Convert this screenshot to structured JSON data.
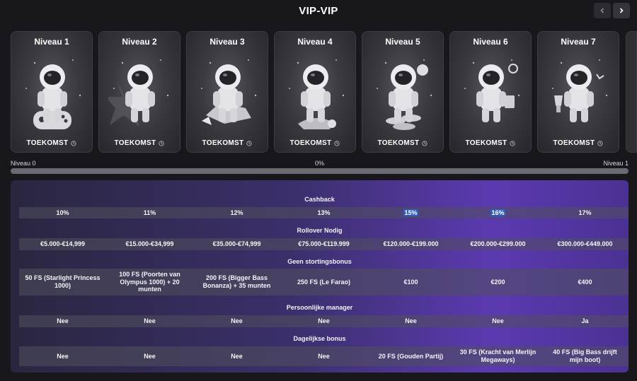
{
  "header": {
    "title": "VIP-VIP"
  },
  "cards": [
    {
      "title": "Niveau 1",
      "status": "TOEKOMST"
    },
    {
      "title": "Niveau 2",
      "status": "TOEKOMST"
    },
    {
      "title": "Niveau 3",
      "status": "TOEKOMST"
    },
    {
      "title": "Niveau 4",
      "status": "TOEKOMST"
    },
    {
      "title": "Niveau 5",
      "status": "TOEKOMST"
    },
    {
      "title": "Niveau 6",
      "status": "TOEKOMST"
    },
    {
      "title": "Niveau 7",
      "status": "TOEKOMST"
    }
  ],
  "progress": {
    "start_label": "Niveau 0",
    "percent_label": "0%",
    "end_label": "Niveau 1",
    "value": 0
  },
  "table": {
    "sections": [
      {
        "title": "Cashback",
        "values": [
          "10%",
          "11%",
          "12%",
          "13%",
          "15%",
          "16%",
          "17%"
        ],
        "highlighted": [
          4,
          5
        ]
      },
      {
        "title": "Rollover Nodig",
        "values": [
          "€5.000-€14,999",
          "€15.000-€34,999",
          "€35.000-€74,999",
          "€75.000-€119.999",
          "€120.000-€199.000",
          "€200.000-€299.000",
          "€300.000-€449.000"
        ]
      },
      {
        "title": "Geen stortingsbonus",
        "values": [
          "50 FS (Starlight Princess 1000)",
          "100 FS (Poorten van Olympus 1000) + 20 munten",
          "200 FS (Bigger Bass Bonanza) + 35 munten",
          "250 FS (Le Farao)",
          "€100",
          "€200",
          "€400"
        ]
      },
      {
        "title": "Persoonlijke manager",
        "values": [
          "Nee",
          "Nee",
          "Nee",
          "Nee",
          "Nee",
          "Nee",
          "Ja"
        ]
      },
      {
        "title": "Dagelijkse bonus",
        "values": [
          "Nee",
          "Nee",
          "Nee",
          "Nee",
          "20 FS (Gouden Partij)",
          "30 FS (Kracht van Merlijn Megaways)",
          "40 FS (Big Bass drijft mijn boot)"
        ]
      }
    ]
  },
  "colors": {
    "accent": "#5b3ab0",
    "highlight": "#2f5fb8",
    "background": "#18181c"
  },
  "icons": {
    "prev": "chevron-left-icon",
    "next": "chevron-right-icon",
    "status": "clock-icon"
  }
}
